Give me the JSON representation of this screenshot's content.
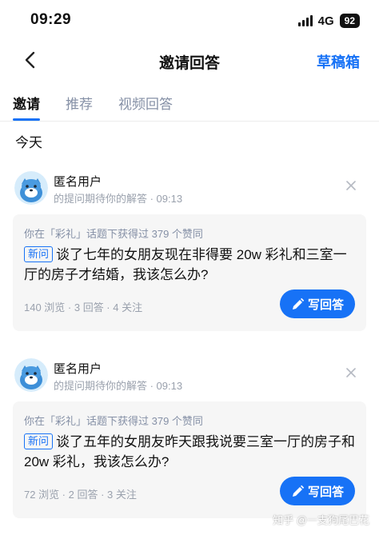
{
  "status_bar": {
    "time": "09:29",
    "network": "4G",
    "battery": "92"
  },
  "nav": {
    "title": "邀请回答",
    "draft_label": "草稿箱",
    "back_icon": "chevron-left-icon"
  },
  "tabs": [
    {
      "label": "邀请",
      "active": true
    },
    {
      "label": "推荐",
      "active": false
    },
    {
      "label": "视频回答",
      "active": false
    }
  ],
  "section_date": "今天",
  "invites": [
    {
      "user": "匿名用户",
      "meta": "的提问期待你的解答 · 09:13",
      "topic_note": "你在「彩礼」话题下获得过 379 个赞同",
      "tag": "新问",
      "question": "谈了七年的女朋友现在非得要 20w 彩礼和三室一厅的房子才结婚，我该怎么办?",
      "stats": "140 浏览 · 3 回答 · 4 关注",
      "answer_label": "写回答"
    },
    {
      "user": "匿名用户",
      "meta": "的提问期待你的解答 · 09:13",
      "topic_note": "你在「彩礼」话题下获得过 379 个赞同",
      "tag": "新问",
      "question": "谈了五年的女朋友昨天跟我说要三室一厅的房子和 20w 彩礼，我该怎么办?",
      "stats": "72 浏览 · 2 回答 · 3 关注",
      "answer_label": "写回答"
    }
  ],
  "watermark": "知乎 @一支狗尾巴花",
  "colors": {
    "accent": "#1772f6",
    "card_bg": "#f6f6f6",
    "muted": "#9aa1ad"
  }
}
